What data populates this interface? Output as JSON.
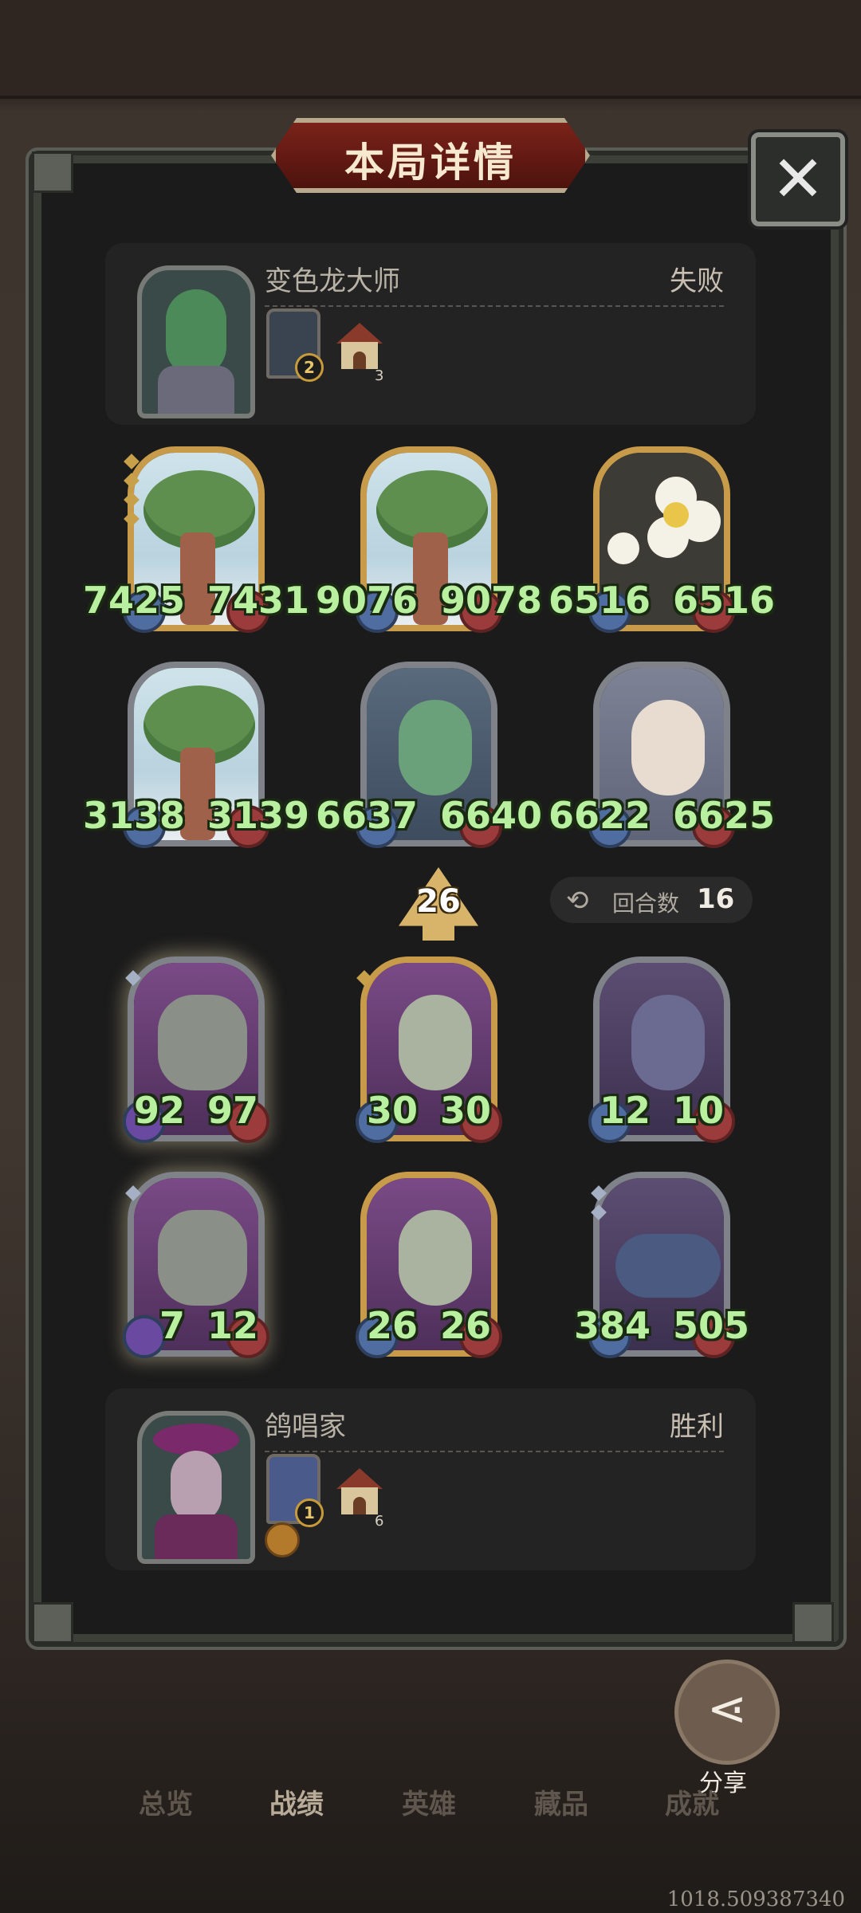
{
  "header": {
    "title": "本局详情",
    "close_icon": "close-icon"
  },
  "opponent": {
    "name": "变色龙大师",
    "result": "失败",
    "hero_badge": "2",
    "tavern_tier": "3"
  },
  "enemy_board": [
    {
      "attack": "7425",
      "health": "7431",
      "art": "tree"
    },
    {
      "attack": "9076",
      "health": "9078",
      "art": "tree"
    },
    {
      "attack": "6516",
      "health": "6516",
      "art": "flower"
    },
    {
      "attack": "3138",
      "health": "3139",
      "art": "tree"
    },
    {
      "attack": "6637",
      "health": "6640",
      "art": "elf"
    },
    {
      "attack": "6622",
      "health": "6625",
      "art": "lady"
    }
  ],
  "match": {
    "level": "26",
    "rounds_label": "回合数",
    "rounds_value": "16"
  },
  "player_board": [
    {
      "attack": "92",
      "health": "97",
      "art": "fish"
    },
    {
      "attack": "30",
      "health": "30",
      "art": "demon"
    },
    {
      "attack": "12",
      "health": "10",
      "art": "spirit"
    },
    {
      "attack": "7",
      "health": "12",
      "art": "fish"
    },
    {
      "attack": "26",
      "health": "26",
      "art": "demon"
    },
    {
      "attack": "384",
      "health": "505",
      "art": "dragon"
    }
  ],
  "player": {
    "name": "鸽唱家",
    "result": "胜利",
    "hero_badge": "1",
    "tavern_tier": "6"
  },
  "share": {
    "label": "分享"
  },
  "nav": {
    "items": [
      "总览",
      "战绩",
      "英雄",
      "藏品",
      "成就"
    ],
    "active": "战绩"
  },
  "debug_coords": "1018.509387340"
}
